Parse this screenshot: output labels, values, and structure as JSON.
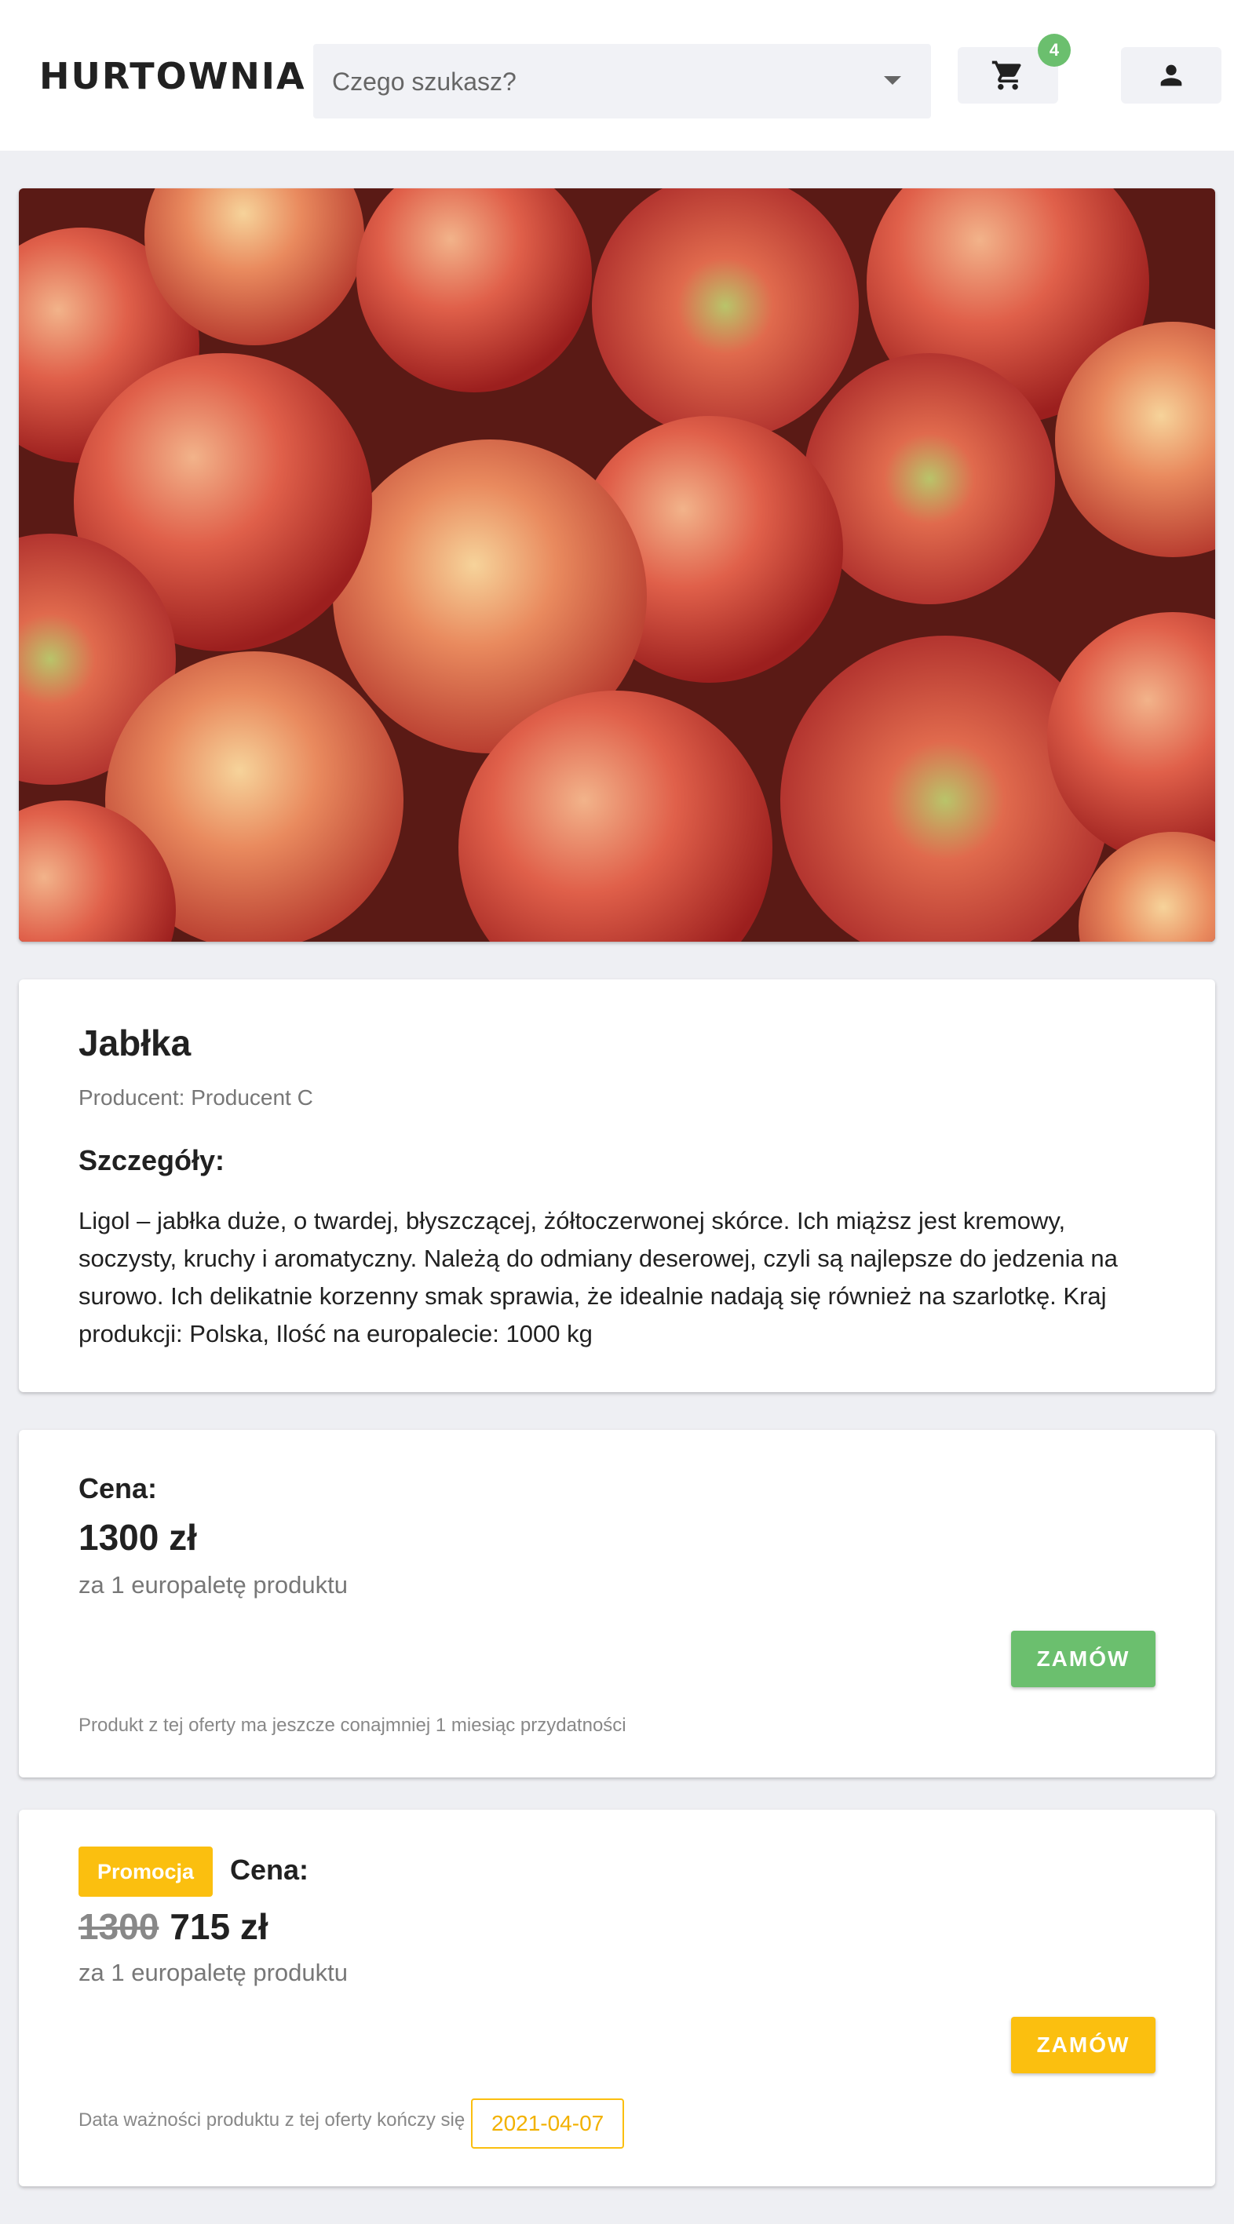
{
  "header": {
    "brand": "HURTOWNIA",
    "search_placeholder": "Czego szukasz?",
    "cart_count": "4",
    "icons": {
      "cart": "cart-icon",
      "user": "user-icon",
      "dropdown": "chevron-down-icon"
    }
  },
  "product": {
    "title": "Jabłka",
    "producer": "Producent: Producent C",
    "details_heading": "Szczegóły:",
    "description": "Ligol – jabłka duże, o twardej, błyszczącej, żółtoczerwonej skórce. Ich miąższ jest kremowy, soczysty, kruchy i aromatyczny. Należą do odmiany deserowej, czyli są najlepsze do jedzenia na surowo. Ich delikatnie korzenny smak sprawia, że idealnie nadają się również na szarlotkę. Kraj produkcji: Polska, Ilość na europalecie: 1000 kg"
  },
  "offers": [
    {
      "price_label": "Cena:",
      "price": "1300 zł",
      "unit": "za 1 europaletę produktu",
      "button": "ZAMÓW",
      "note": "Produkt z tej oferty ma jeszcze conajmniej 1 miesiąc przydatności"
    },
    {
      "promo_label": "Promocja",
      "price_label": "Cena:",
      "old_price": "1300",
      "price": "715 zł",
      "unit": "za 1 europaletę produktu",
      "button": "ZAMÓW",
      "note": "Data ważności produktu z tej oferty kończy się",
      "expiry_date": "2021-04-07"
    }
  ],
  "colors": {
    "accent_green": "#6bbf6e",
    "accent_yellow": "#fbbf0f",
    "background": "#eeeff3"
  }
}
